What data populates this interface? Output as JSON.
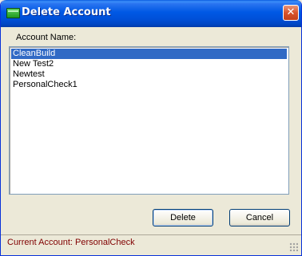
{
  "window": {
    "title": "Delete Account",
    "close_glyph": "✕"
  },
  "form": {
    "account_name_label": "Account Name:"
  },
  "accounts": {
    "items": [
      "CleanBuild",
      "New Test2",
      "Newtest",
      "PersonalCheck1"
    ],
    "selected": "CleanBuild"
  },
  "buttons": {
    "delete_label": "Delete",
    "cancel_label": "Cancel"
  },
  "status": {
    "text": "Current Account: PersonalCheck"
  },
  "icons": {
    "app": "green-folder-icon",
    "close": "close-icon",
    "grip": "resize-grip-icon"
  },
  "colors": {
    "titlebar": "#0058e4",
    "selection": "#316ac5",
    "status_text": "#800000",
    "close_button": "#d9532c"
  }
}
